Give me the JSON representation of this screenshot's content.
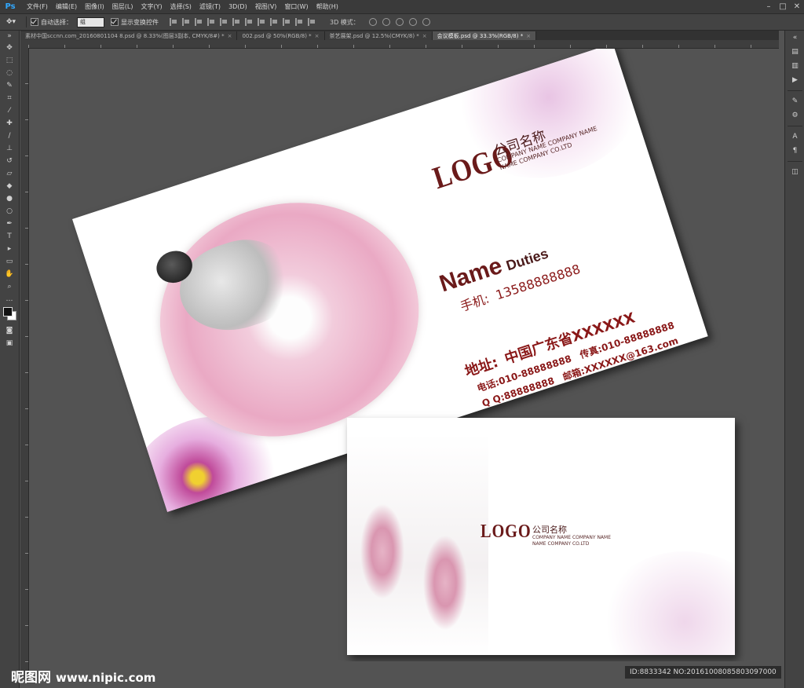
{
  "app": {
    "logo": "Ps",
    "menu": [
      "文件(F)",
      "编辑(E)",
      "图像(I)",
      "图层(L)",
      "文字(Y)",
      "选择(S)",
      "滤镜(T)",
      "3D(D)",
      "视图(V)",
      "窗口(W)",
      "帮助(H)"
    ]
  },
  "options": {
    "auto_select_label": "自动选择：",
    "auto_select_value": "组",
    "show_transform_label": "显示变换控件",
    "mode_label": "3D 模式："
  },
  "tabs": [
    {
      "label": "素材中国sccnn.com_20160801104 8.psd @ 8.33%(图层3副本, CMYK/8#) *",
      "active": false
    },
    {
      "label": "002.psd @ 50%(RGB/8) *",
      "active": false
    },
    {
      "label": "茶艺展架.psd @ 12.5%(CMYK/8) *",
      "active": false
    },
    {
      "label": "会议模板.psd @ 33.3%(RGB/8) *",
      "active": true
    }
  ],
  "card_front": {
    "logo": "LOGO",
    "company_cn": "公司名称",
    "company_en1": "COMPANY NAME COMPANY NAME",
    "company_en2": "NAME COMPANY CO.LTD",
    "name": "Name",
    "duties": "Duties",
    "mobile_label": "手机:",
    "mobile_value": "13588888888",
    "address_label": "地址:",
    "address_value": "中国广东省XXXXXX",
    "tel": "电话:010-88888888",
    "fax": "传真:010-88888888",
    "qq": "Q Q:88888888",
    "email": "邮箱:XXXXXX@163.com"
  },
  "card_back": {
    "logo": "LOGO",
    "company_cn": "公司名称",
    "company_en1": "COMPANY NAME COMPANY NAME",
    "company_en2": "NAME COMPANY CO.LTD"
  },
  "watermark": {
    "site_cn": "昵图网",
    "site_url": "www.nipic.com",
    "id_text": "ID:8833342 NO:20161008085803097000"
  }
}
